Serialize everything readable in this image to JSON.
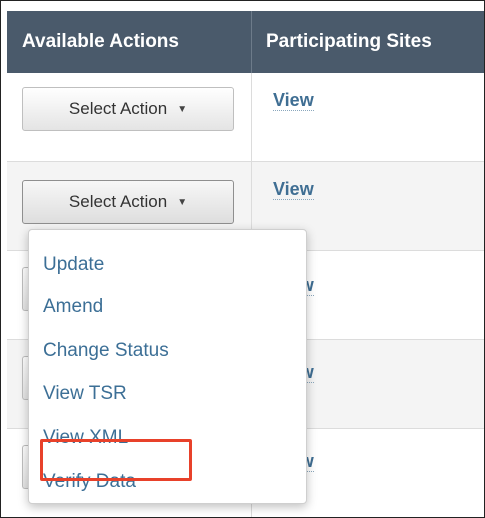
{
  "table": {
    "columns": [
      "Available Actions",
      "Participating Sites"
    ],
    "rows": [
      {
        "action_label": "Select Action",
        "sites_link": "View"
      },
      {
        "action_label": "Select Action",
        "sites_link": "View"
      },
      {
        "sites_link": "View"
      },
      {
        "sites_link": "View"
      },
      {
        "sites_link": "View"
      }
    ]
  },
  "dropdown_menu": {
    "items": [
      "Update",
      "Amend",
      "Change Status",
      "View TSR",
      "View XML",
      "Verify Data"
    ],
    "highlighted_item": "Verify Data"
  },
  "colors": {
    "header_bg": "#4a5a6b",
    "link": "#3f6e93",
    "menu_link": "#3c6f96",
    "highlight_border": "#e8412a"
  },
  "icons": {
    "caret": "caret-down-icon"
  }
}
